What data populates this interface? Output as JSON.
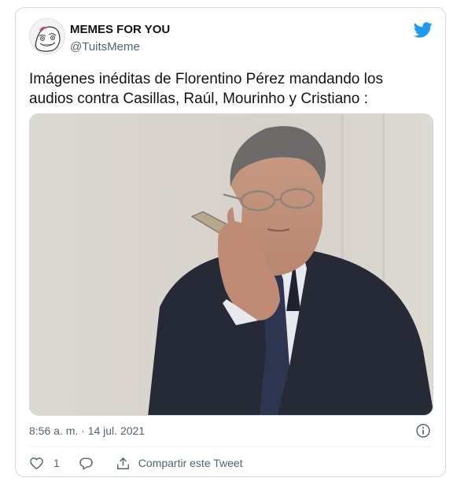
{
  "author": {
    "name": "MEMES FOR YOU",
    "handle": "@TuitsMeme"
  },
  "tweet": {
    "text": "Imágenes inéditas de Florentino Pérez mandando los\naudios contra Casillas, Raúl, Mourinho y Cristiano :",
    "timestamp": "8:56 a. m. · 14 jul. 2021"
  },
  "actions": {
    "like_count": "1",
    "share_label": "Compartir este Tweet"
  },
  "icons": {
    "brand": "twitter-bird-icon",
    "info": "info-icon",
    "like": "heart-icon",
    "reply": "reply-bubble-icon",
    "share": "share-icon"
  },
  "colors": {
    "twitter_blue": "#1d9bf0",
    "text_primary": "#0f1419",
    "text_secondary": "#536471",
    "border": "#cfd9de"
  }
}
